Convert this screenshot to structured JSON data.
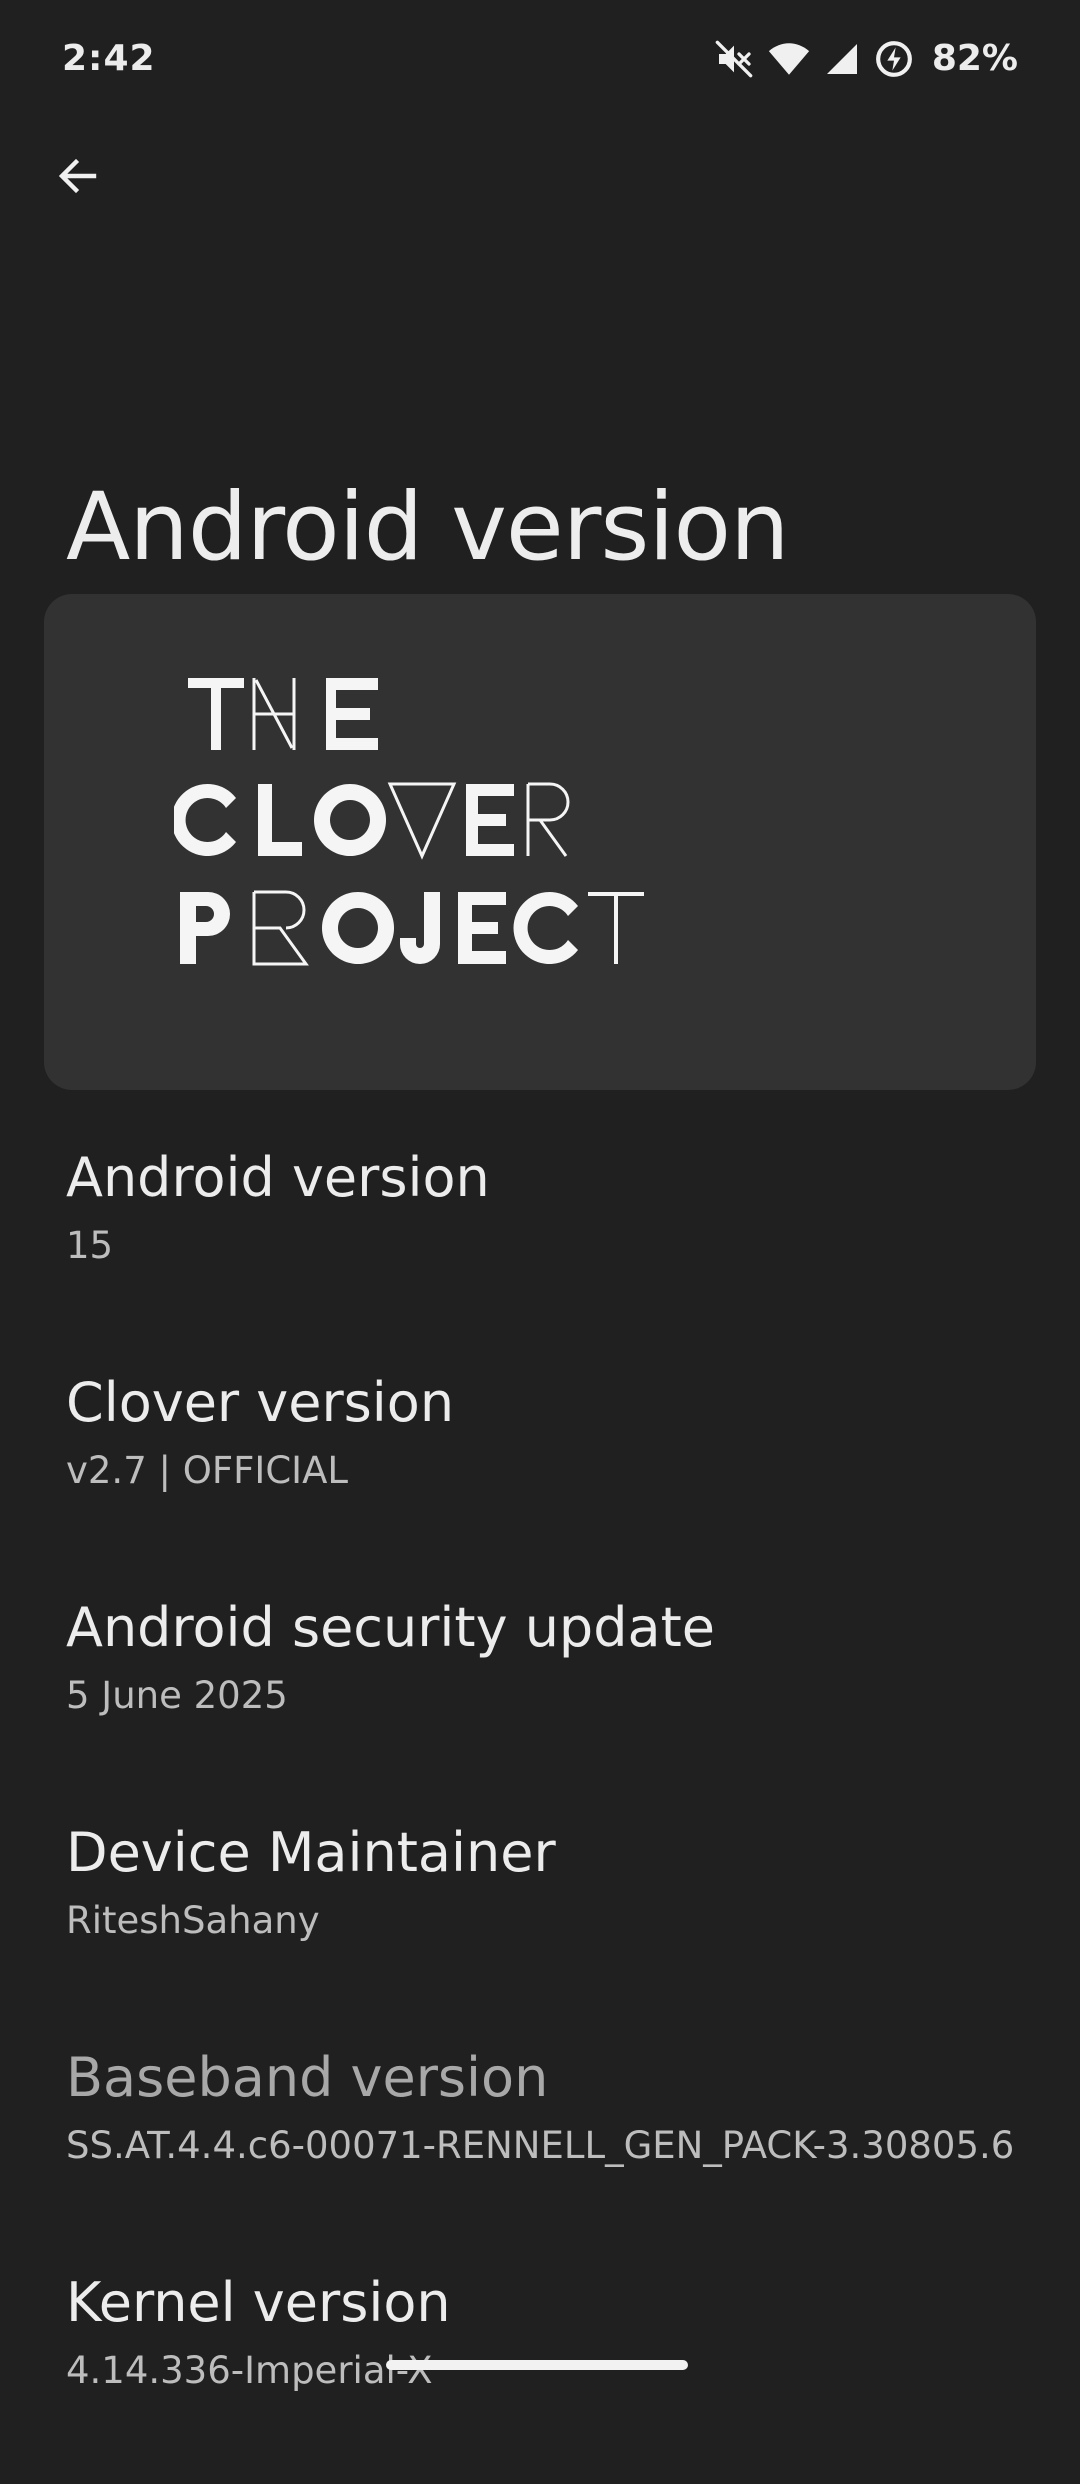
{
  "status_bar": {
    "time": "2:42",
    "battery": "82%",
    "icons": [
      "mute-icon",
      "wifi-icon",
      "signal-icon",
      "battery-saver-icon"
    ]
  },
  "header": {
    "back_icon": "arrow-back-icon",
    "title": "Android version"
  },
  "logo": {
    "lines": [
      "THE",
      "CLOVER",
      "PROJECT"
    ]
  },
  "items": [
    {
      "title": "Android version",
      "value": "15"
    },
    {
      "title": "Clover version",
      "value": "v2.7 | OFFICIAL"
    },
    {
      "title": "Android security update",
      "value": "5 June 2025"
    },
    {
      "title": "Device Maintainer",
      "value": "RiteshSahany"
    },
    {
      "title": "Baseband version",
      "value": "SS.AT.4.4.c6-00071-RENNELL_GEN_PACK-3.30805.6"
    },
    {
      "title": "Kernel version",
      "value": "4.14.336-Imperial-X"
    }
  ],
  "colors": {
    "background": "#202020",
    "card": "#323232",
    "text": "#ECECEC",
    "subtext": "#BDBDBD"
  }
}
